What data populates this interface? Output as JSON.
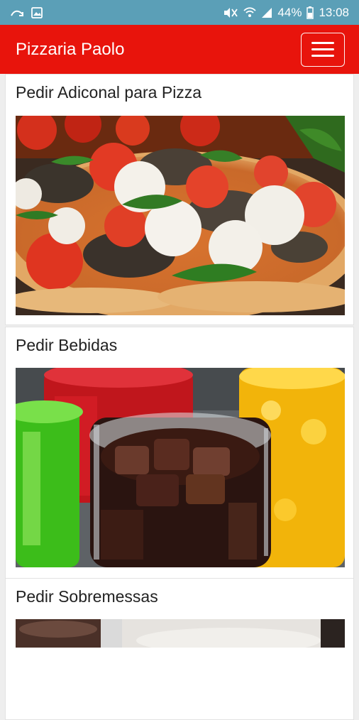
{
  "status_bar": {
    "battery": "44%",
    "time": "13:08",
    "background": "#5b9fb7"
  },
  "navbar": {
    "brand": "Pizzaria Paolo",
    "background": "#e8140c",
    "menu_icon": "hamburger-menu-icon"
  },
  "cards": [
    {
      "title": "Pedir Adiconal para Pizza",
      "image": "pizza-photo"
    },
    {
      "title": "Pedir Bebidas",
      "image": "drinks-photo"
    },
    {
      "title": "Pedir Sobremessas",
      "image": "dessert-photo"
    }
  ]
}
